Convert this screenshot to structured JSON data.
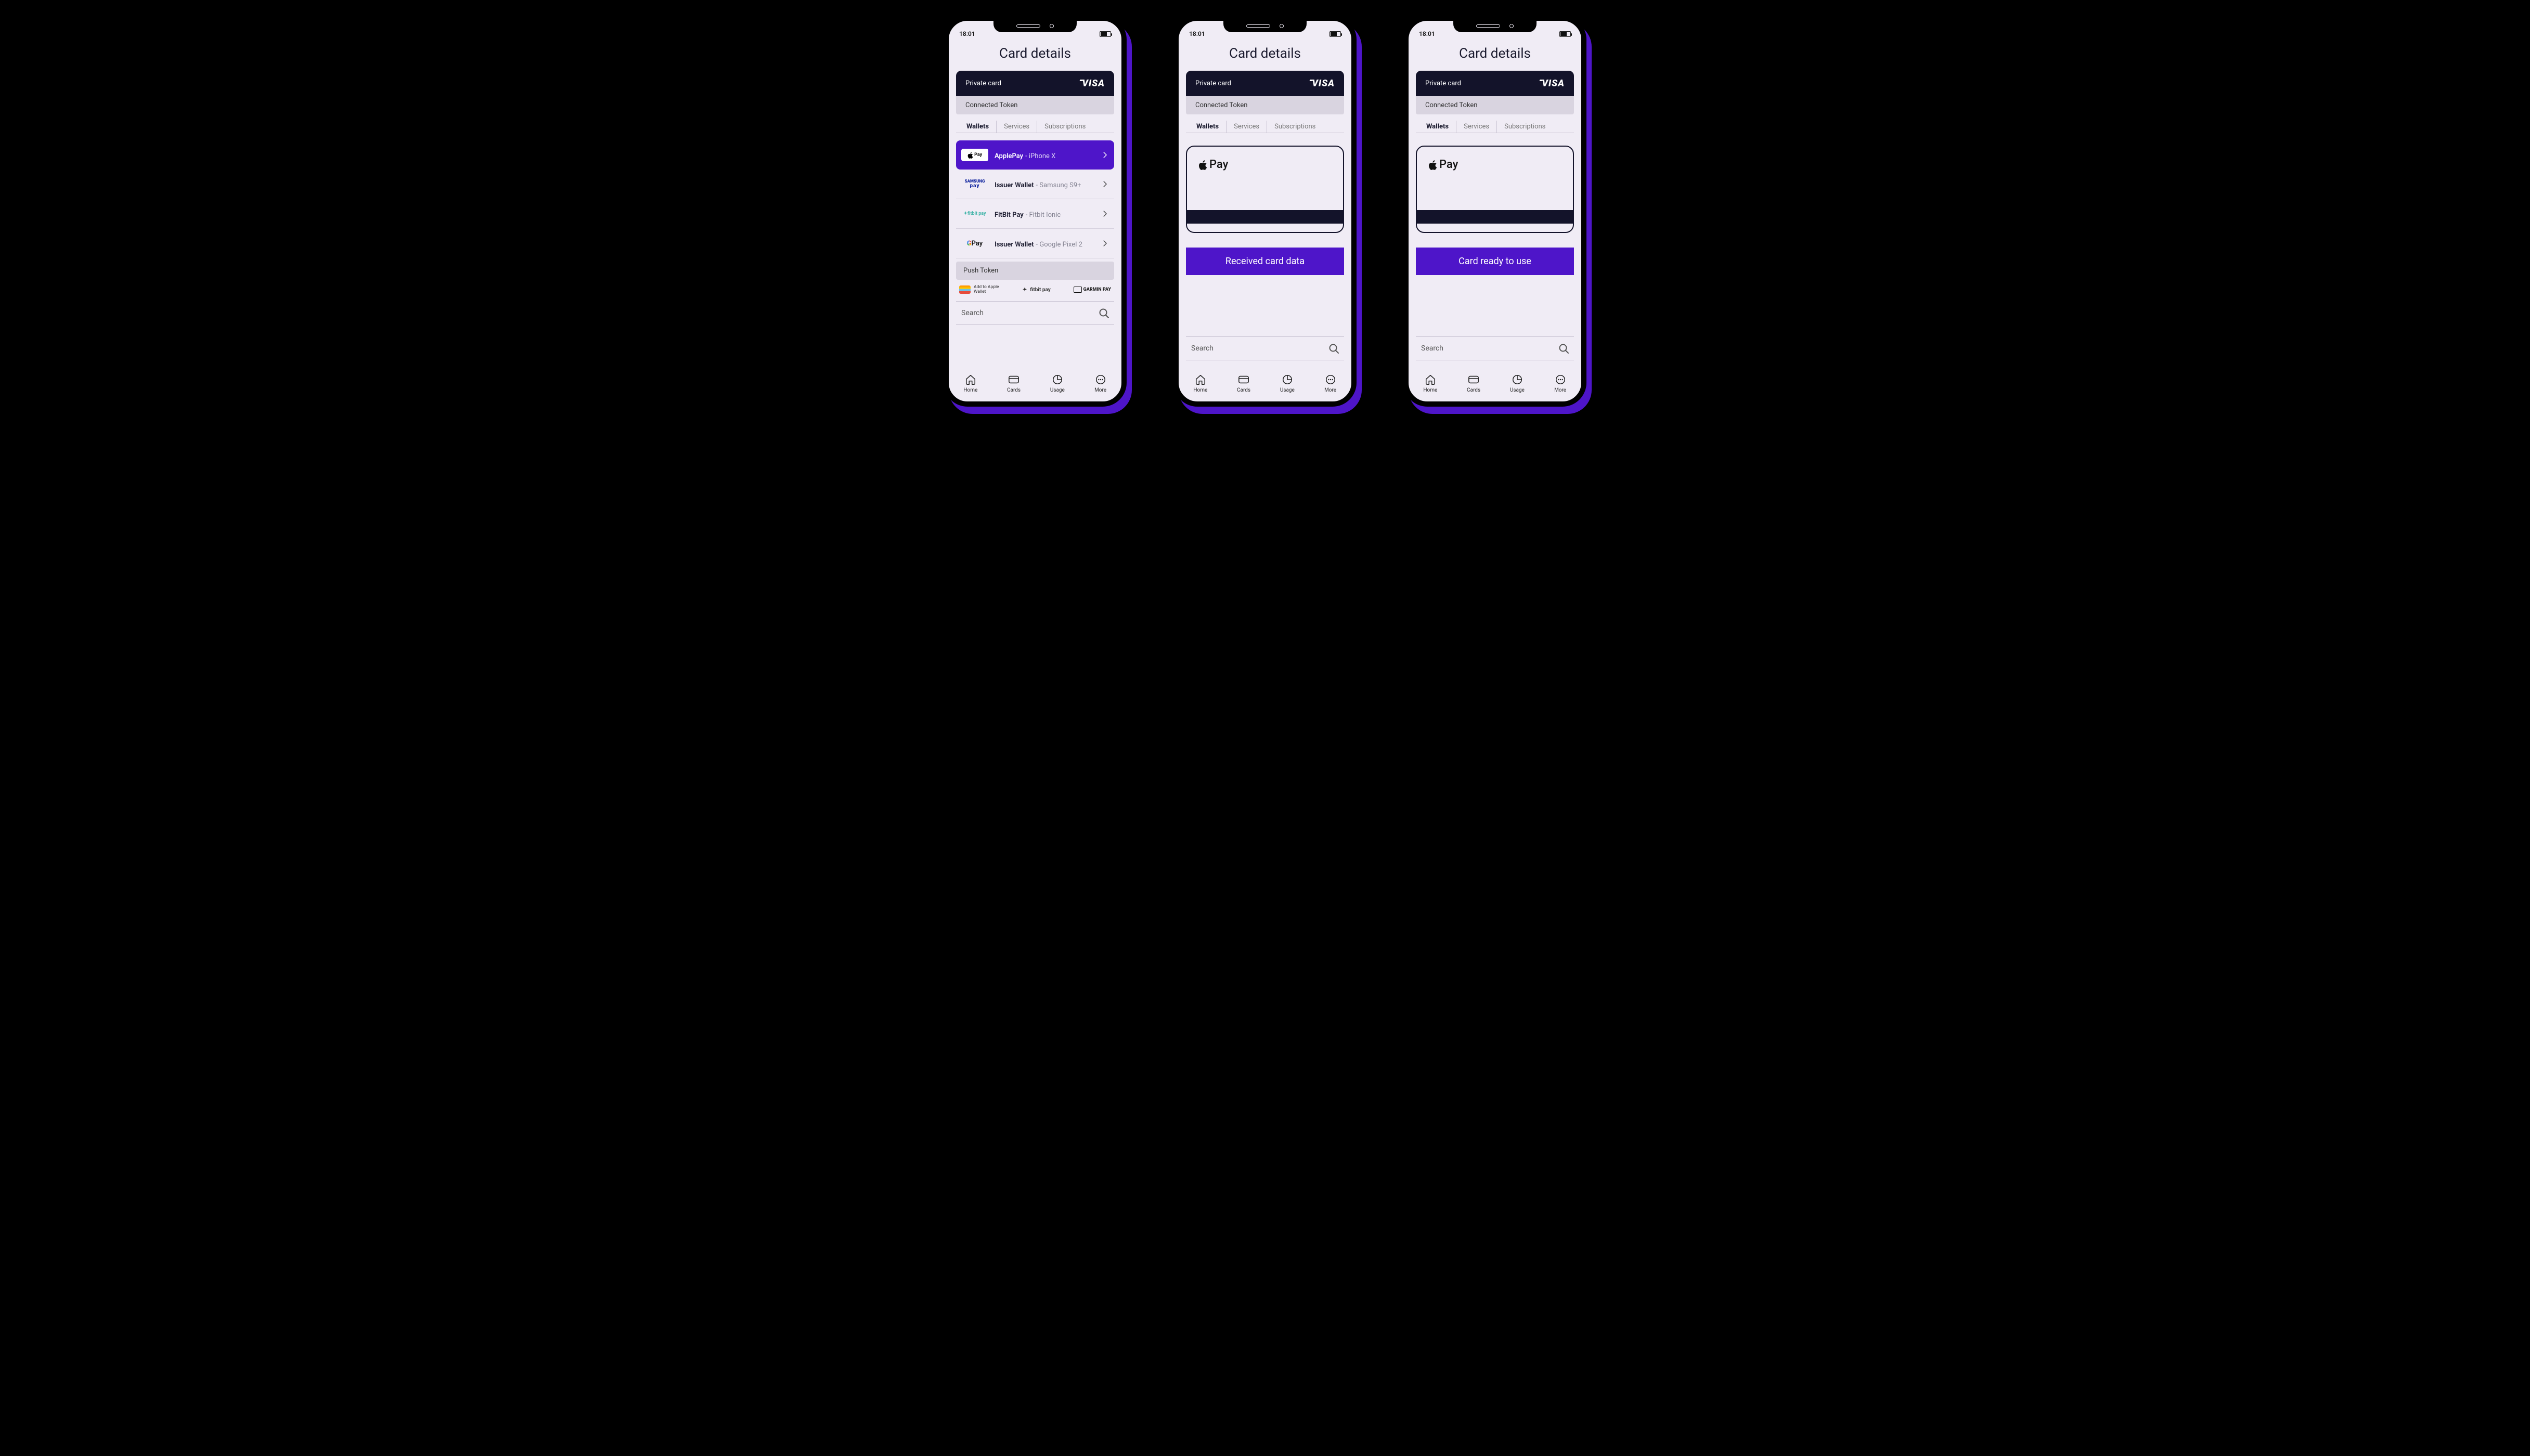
{
  "status": {
    "time": "18:01"
  },
  "page": {
    "title": "Card details"
  },
  "card": {
    "label": "Private card",
    "brand": "VISA",
    "connected": "Connected Token"
  },
  "tabs": [
    "Wallets",
    "Services",
    "Subscriptions"
  ],
  "wallets": [
    {
      "logo": "apple",
      "name": "ApplePay",
      "device": "iPhone X"
    },
    {
      "logo": "samsung",
      "name": "Issuer Wallet",
      "device": "Samsung S9+"
    },
    {
      "logo": "fitbit",
      "name": "FitBit Pay",
      "device": "Fitbit Ionic"
    },
    {
      "logo": "gpay",
      "name": "Issuer Wallet",
      "device": "Google Pixel 2"
    }
  ],
  "push": {
    "header": "Push Token",
    "apple_wallet": "Add to Apple Wallet",
    "fitbit": "fitbit pay",
    "garmin": "GARMIN PAY"
  },
  "search": {
    "placeholder": "Search"
  },
  "apple_pay_label": "Pay",
  "buttons": {
    "received": "Received card data",
    "ready": "Card ready to use"
  },
  "nav": [
    "Home",
    "Cards",
    "Usage",
    "More"
  ]
}
